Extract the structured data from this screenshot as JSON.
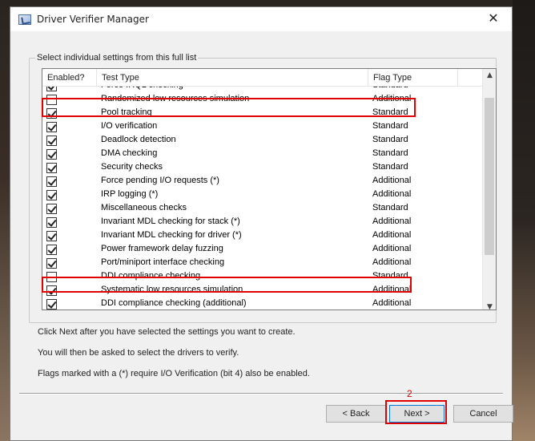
{
  "window": {
    "title": "Driver Verifier Manager",
    "close_glyph": "✕",
    "icon": "verifier-app-icon"
  },
  "group": {
    "label": "Select individual settings from this full list"
  },
  "table": {
    "columns": [
      "Enabled?",
      "Test Type",
      "Flag Type"
    ],
    "rows": [
      {
        "enabled": true,
        "test": "Force IRQL checking",
        "flag": "Standard"
      },
      {
        "enabled": false,
        "test": "Randomized low resources simulation",
        "flag": "Additional"
      },
      {
        "enabled": true,
        "test": "Pool tracking",
        "flag": "Standard"
      },
      {
        "enabled": true,
        "test": "I/O verification",
        "flag": "Standard"
      },
      {
        "enabled": true,
        "test": "Deadlock detection",
        "flag": "Standard"
      },
      {
        "enabled": true,
        "test": "DMA checking",
        "flag": "Standard"
      },
      {
        "enabled": true,
        "test": "Security checks",
        "flag": "Standard"
      },
      {
        "enabled": true,
        "test": "Force pending I/O requests (*)",
        "flag": "Additional"
      },
      {
        "enabled": true,
        "test": "IRP logging (*)",
        "flag": "Additional"
      },
      {
        "enabled": true,
        "test": "Miscellaneous checks",
        "flag": "Standard"
      },
      {
        "enabled": true,
        "test": "Invariant MDL checking for stack (*)",
        "flag": "Additional"
      },
      {
        "enabled": true,
        "test": "Invariant MDL checking for driver (*)",
        "flag": "Additional"
      },
      {
        "enabled": true,
        "test": "Power framework delay fuzzing",
        "flag": "Additional"
      },
      {
        "enabled": true,
        "test": "Port/miniport interface checking",
        "flag": "Additional"
      },
      {
        "enabled": false,
        "test": "DDI compliance checking",
        "flag": "Standard"
      },
      {
        "enabled": true,
        "test": "Systematic low resources simulation",
        "flag": "Additional"
      },
      {
        "enabled": true,
        "test": "DDI compliance checking (additional)",
        "flag": "Additional"
      }
    ],
    "scroll_up_glyph": "▲",
    "scroll_down_glyph": "▼"
  },
  "info": {
    "line1": "Click Next after you have selected the settings you want to create.",
    "line2": "You will then be asked to select the drivers to verify.",
    "line3": "Flags marked with a (*) require I/O Verification (bit 4) also be enabled."
  },
  "buttons": {
    "back": "< Back",
    "next": "Next >",
    "cancel": "Cancel"
  },
  "annotation": {
    "step_number": "2",
    "highlight_color": "#e00000"
  }
}
